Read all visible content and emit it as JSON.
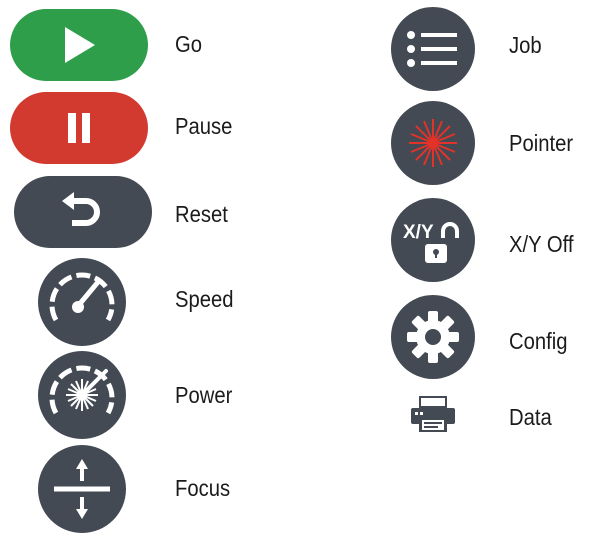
{
  "colors": {
    "dark": "#434a53",
    "go": "#2e9e4a",
    "pause": "#d33a2f",
    "laser": "#e2322a"
  },
  "left": [
    {
      "label": "Go",
      "icon": "play-icon"
    },
    {
      "label": "Pause",
      "icon": "pause-icon"
    },
    {
      "label": "Reset",
      "icon": "undo-arrow-icon"
    },
    {
      "label": "Speed",
      "icon": "speedometer-icon"
    },
    {
      "label": "Power",
      "icon": "laser-gauge-icon"
    },
    {
      "label": "Focus",
      "icon": "focus-arrows-icon"
    }
  ],
  "right": [
    {
      "label": "Job",
      "icon": "list-icon"
    },
    {
      "label": "Pointer",
      "icon": "laser-pointer-icon"
    },
    {
      "label": "X/Y Off",
      "icon": "xy-unlock-icon",
      "badge": "X/Y"
    },
    {
      "label": "Config",
      "icon": "gear-icon"
    },
    {
      "label": "Data",
      "icon": "printer-icon"
    }
  ]
}
